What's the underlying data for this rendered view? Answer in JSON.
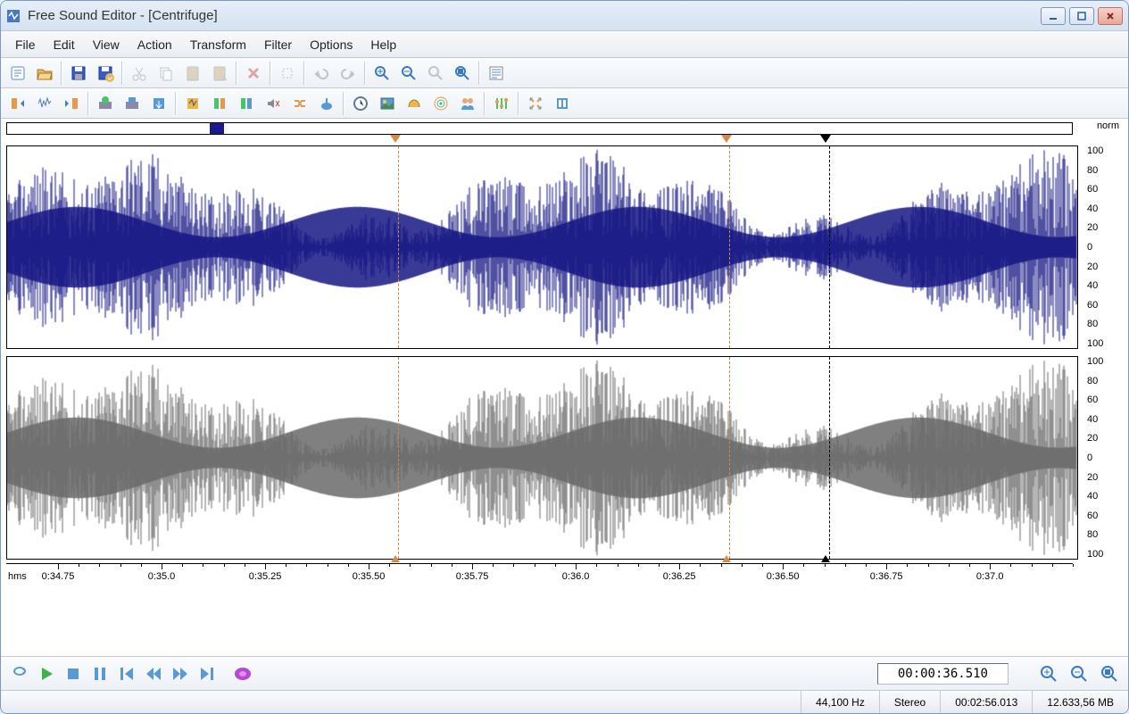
{
  "window": {
    "title": "Free Sound Editor - [Centrifuge]"
  },
  "menu": [
    "File",
    "Edit",
    "View",
    "Action",
    "Transform",
    "Filter",
    "Options",
    "Help"
  ],
  "amp_label": "norm",
  "amp_ticks": [
    "100",
    "80",
    "60",
    "40",
    "20",
    "0",
    "20",
    "40",
    "60",
    "80",
    "100"
  ],
  "timeline": {
    "unit": "hms",
    "labels": [
      "0:34.75",
      "0:35.0",
      "0:35.25",
      "0:35.50",
      "0:35.75",
      "0:36.0",
      "0:36.25",
      "0:36.50",
      "0:36.75",
      "0:37.0"
    ],
    "start": 34.625,
    "end": 37.2
  },
  "markers": {
    "orange1_pct": 36.5,
    "orange2_pct": 67.5,
    "black_pct": 76.8
  },
  "overview": {
    "sel_left_pct": 19.0,
    "sel_width_pct": 1.4
  },
  "transport": {
    "position": "00:00:36.510"
  },
  "status": {
    "sample_rate": "44,100 Hz",
    "channels": "Stereo",
    "duration": "00:02:56.013",
    "size": "12.633,56 MB"
  },
  "colors": {
    "wave_left": "#161684",
    "wave_right": "#6a6a6a",
    "marker_orange": "#d98b44"
  }
}
